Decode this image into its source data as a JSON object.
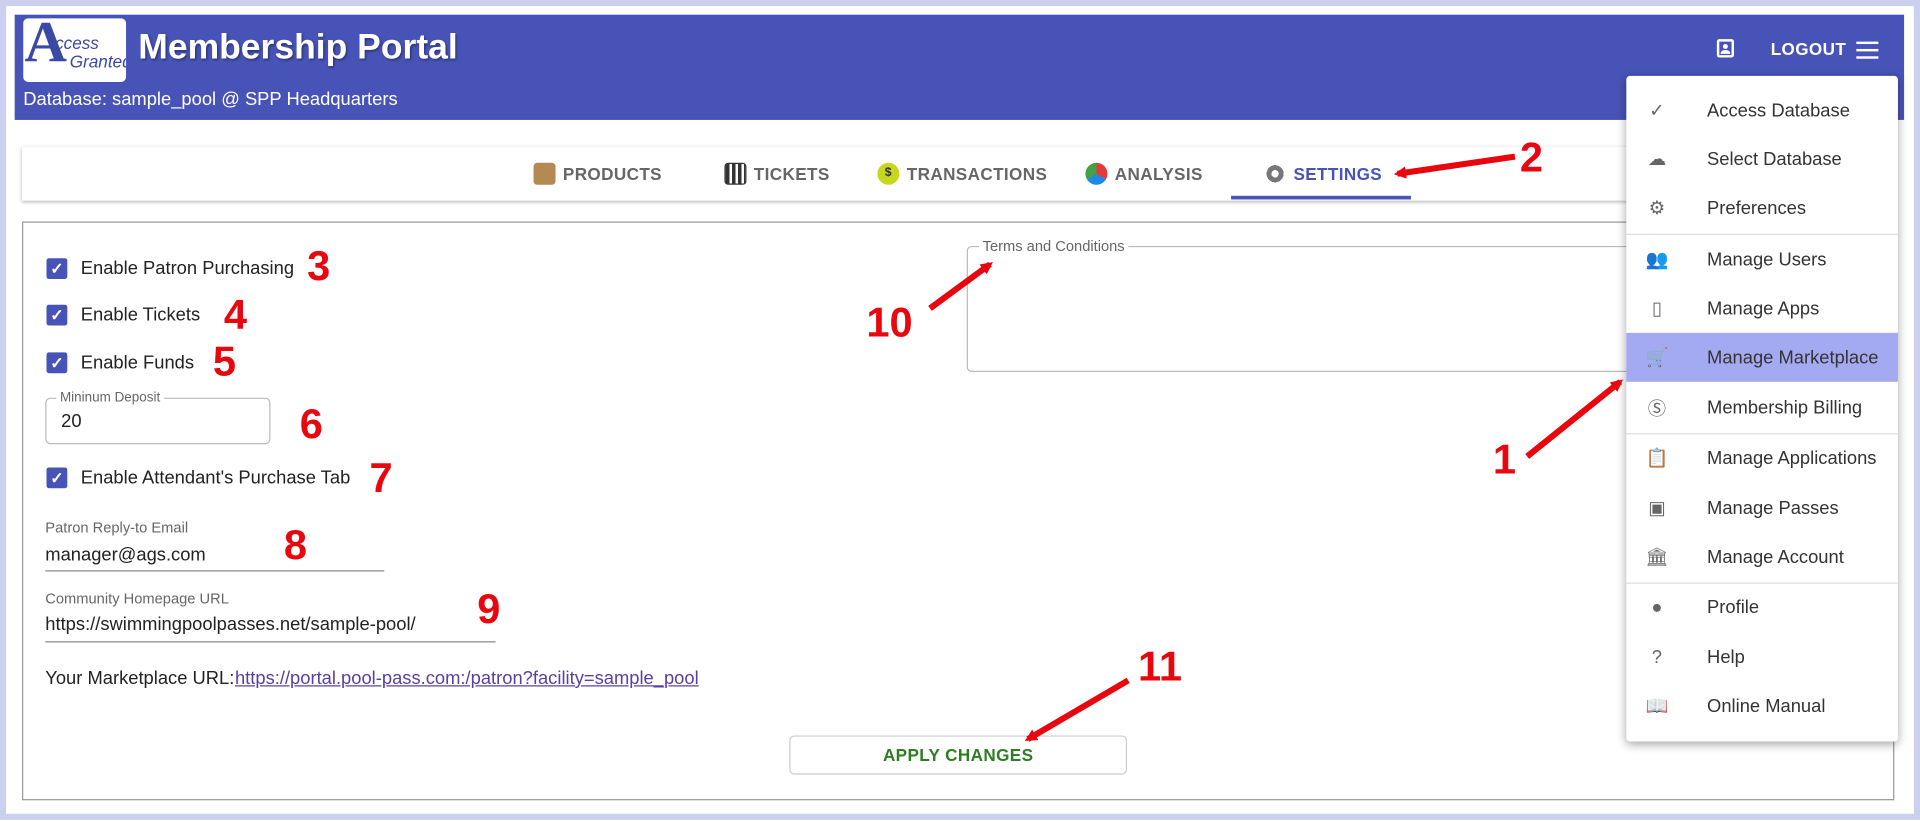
{
  "app": {
    "title": "Membership Portal",
    "database_line": "Database: sample_pool @ SPP Headquarters",
    "logo": {
      "big_letter": "A",
      "word1": "ccess",
      "word2": "Granted"
    },
    "logout_label": "LOGOUT",
    "header_color": "#4753b7"
  },
  "tabs": [
    {
      "label": "PRODUCTS",
      "icon": "box-icon"
    },
    {
      "label": "TICKETS",
      "icon": "qr-code-icon"
    },
    {
      "label": "TRANSACTIONS",
      "icon": "coin-icon"
    },
    {
      "label": "ANALYSIS",
      "icon": "pie-chart-icon"
    },
    {
      "label": "SETTINGS",
      "icon": "gear-icon",
      "active": true
    }
  ],
  "settings": {
    "enable_patron_purchasing": {
      "label": "Enable Patron Purchasing",
      "checked": true
    },
    "enable_tickets": {
      "label": "Enable Tickets",
      "checked": true
    },
    "enable_funds": {
      "label": "Enable Funds",
      "checked": true
    },
    "minimum_deposit": {
      "label": "Mininum Deposit",
      "value": "20"
    },
    "enable_attendant_purchase_tab": {
      "label": "Enable Attendant's Purchase Tab",
      "checked": true
    },
    "patron_reply_email": {
      "label": "Patron Reply-to Email",
      "value": "manager@ags.com"
    },
    "community_homepage_url": {
      "label": "Community Homepage URL",
      "value": "https://swimmingpoolpasses.net/sample-pool/"
    },
    "marketplace_url": {
      "label": "Your Marketplace URL:",
      "value": "https://portal.pool-pass.com:/patron?facility=sample_pool"
    },
    "terms": {
      "label": "Terms and Conditions",
      "value": ""
    },
    "apply_label": "APPLY CHANGES"
  },
  "menu": {
    "items": [
      {
        "label": "Access Database",
        "icon": "check-icon"
      },
      {
        "label": "Select Database",
        "icon": "cloud-icon"
      },
      {
        "label": "Preferences",
        "icon": "gear-icon"
      },
      {
        "label": "Manage Users",
        "icon": "people-icon"
      },
      {
        "label": "Manage Apps",
        "icon": "phone-icon"
      },
      {
        "label": "Manage Marketplace",
        "icon": "cart-icon",
        "selected": true
      },
      {
        "label": "Membership Billing",
        "icon": "dollar-circle-icon"
      },
      {
        "label": "Manage Applications",
        "icon": "clipboard-icon"
      },
      {
        "label": "Manage Passes",
        "icon": "badge-icon"
      },
      {
        "label": "Manage Account",
        "icon": "bank-icon"
      },
      {
        "label": "Profile",
        "icon": "account-circle-icon"
      },
      {
        "label": "Help",
        "icon": "help-circle-icon"
      },
      {
        "label": "Online Manual",
        "icon": "book-icon"
      }
    ]
  },
  "annotations": [
    "1",
    "2",
    "3",
    "4",
    "5",
    "6",
    "7",
    "8",
    "9",
    "10",
    "11"
  ]
}
